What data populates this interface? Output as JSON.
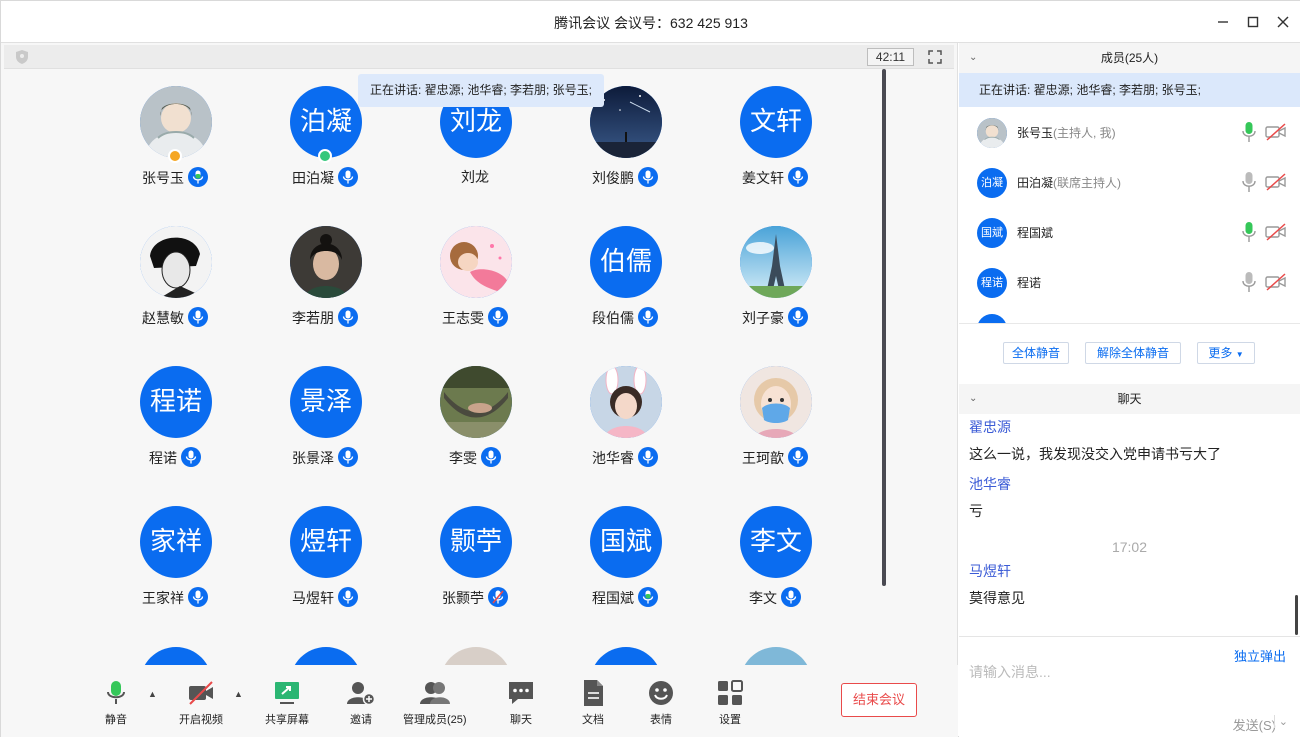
{
  "window": {
    "title": "腾讯会议 会议号：632 425 913"
  },
  "meeting": {
    "timer": "42:11",
    "speaking": "正在讲话: 翟忠源; 池华睿; 李若朋; 张号玉;"
  },
  "colors": {
    "accent": "#0a6cf0",
    "danger": "#e94a4a",
    "mic_active": "#35c759",
    "host_badge": "#f5a623",
    "cohost_badge": "#34c77b"
  },
  "participants": [
    {
      "name": "张号玉",
      "avatar_text": "",
      "avatar": "photo-anime-boy",
      "mic": "active",
      "role": "host"
    },
    {
      "name": "田泊凝",
      "avatar_text": "泊凝",
      "avatar": "initials",
      "mic": "on",
      "role": "cohost"
    },
    {
      "name": "刘龙",
      "avatar_text": "刘龙",
      "avatar": "initials",
      "mic": "none"
    },
    {
      "name": "刘俊鹏",
      "avatar_text": "",
      "avatar": "photo-night-sky",
      "mic": "on"
    },
    {
      "name": "姜文轩",
      "avatar_text": "文轩",
      "avatar": "initials",
      "mic": "on"
    },
    {
      "name": "赵慧敏",
      "avatar_text": "",
      "avatar": "photo-bw-portrait",
      "mic": "on"
    },
    {
      "name": "李若朋",
      "avatar_text": "",
      "avatar": "photo-woman-portrait",
      "mic": "on"
    },
    {
      "name": "王志雯",
      "avatar_text": "",
      "avatar": "photo-cartoon-girl",
      "mic": "on"
    },
    {
      "name": "段伯儒",
      "avatar_text": "伯儒",
      "avatar": "initials",
      "mic": "on"
    },
    {
      "name": "刘子豪",
      "avatar_text": "",
      "avatar": "photo-eiffel-tower",
      "mic": "on"
    },
    {
      "name": "程诺",
      "avatar_text": "程诺",
      "avatar": "initials",
      "mic": "on"
    },
    {
      "name": "张景泽",
      "avatar_text": "景泽",
      "avatar": "initials",
      "mic": "on"
    },
    {
      "name": "李雯",
      "avatar_text": "",
      "avatar": "photo-hammock",
      "mic": "on"
    },
    {
      "name": "池华睿",
      "avatar_text": "",
      "avatar": "photo-bunny-girl",
      "mic": "on"
    },
    {
      "name": "王珂歆",
      "avatar_text": "",
      "avatar": "photo-masked-girl",
      "mic": "on"
    },
    {
      "name": "王家祥",
      "avatar_text": "家祥",
      "avatar": "initials",
      "mic": "on"
    },
    {
      "name": "马煜轩",
      "avatar_text": "煜轩",
      "avatar": "initials",
      "mic": "on"
    },
    {
      "name": "张颢苧",
      "avatar_text": "颢苧",
      "avatar": "initials",
      "mic": "muted"
    },
    {
      "name": "程国斌",
      "avatar_text": "国斌",
      "avatar": "initials",
      "mic": "active"
    },
    {
      "name": "李文",
      "avatar_text": "李文",
      "avatar": "initials",
      "mic": "on"
    }
  ],
  "toolbar": {
    "mute": "静音",
    "video": "开启视频",
    "share": "共享屏幕",
    "invite": "邀请",
    "manage": "管理成员(25)",
    "chat": "聊天",
    "docs": "文档",
    "emoji": "表情",
    "settings": "设置",
    "end": "结束会议"
  },
  "members_panel": {
    "title": "成员(25人)",
    "speaking": "正在讲话: 翟忠源; 池华睿; 李若朋; 张号玉;",
    "items": [
      {
        "name": "张号玉",
        "role": "(主持人, 我)",
        "avatar_text": "",
        "mic": "active"
      },
      {
        "name": "田泊凝",
        "role": "(联席主持人)",
        "avatar_text": "泊凝",
        "mic": "idle"
      },
      {
        "name": "程国斌",
        "role": "",
        "avatar_text": "国斌",
        "mic": "active"
      },
      {
        "name": "程诺",
        "role": "",
        "avatar_text": "程诺",
        "mic": "idle"
      }
    ],
    "mute_all": "全体静音",
    "unmute_all": "解除全体静音",
    "more": "更多"
  },
  "chat_panel": {
    "title": "聊天",
    "messages": [
      {
        "sender": "翟忠源",
        "text": "这么一说，我发现没交入党申请书亏大了"
      },
      {
        "sender": "池华睿",
        "text": "亏"
      },
      {
        "time": "17:02"
      },
      {
        "sender": "马煜轩",
        "text": "莫得意见"
      }
    ],
    "popout": "独立弹出",
    "placeholder": "请输入消息...",
    "send": "发送(S)"
  }
}
